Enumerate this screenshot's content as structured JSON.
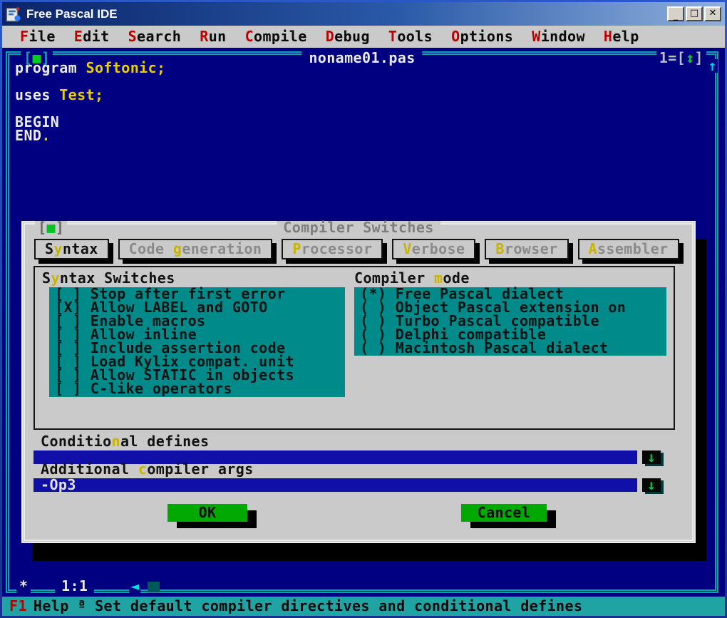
{
  "titlebar": {
    "title": "Free Pascal IDE",
    "minimize_glyph": "_",
    "maximize_glyph": "□",
    "close_glyph": "✕"
  },
  "menu": {
    "items": [
      {
        "hot": "F",
        "rest": "ile"
      },
      {
        "hot": "E",
        "rest": "dit"
      },
      {
        "hot": "S",
        "rest": "earch"
      },
      {
        "hot": "R",
        "rest": "un"
      },
      {
        "hot": "C",
        "rest": "ompile"
      },
      {
        "hot": "D",
        "rest": "ebug"
      },
      {
        "hot": "T",
        "rest": "ools"
      },
      {
        "hot": "O",
        "rest": "ptions"
      },
      {
        "hot": "W",
        "rest": "indow"
      },
      {
        "hot": "H",
        "rest": "elp"
      }
    ]
  },
  "editor": {
    "close_bracket_l": "[",
    "close_icon": "■",
    "close_bracket_r": "]",
    "title": "noname01.pas",
    "badge_pre": "1=[",
    "badge_icon": "↕",
    "badge_post": "]",
    "scroll_up_icon": "↑",
    "modified_star": "*",
    "cursor_pos": "1:1",
    "scroll_left_icon": "◄",
    "code": [
      {
        "kw": "program ",
        "id": "Softonic;"
      },
      {
        "kw": "",
        "id": ""
      },
      {
        "kw": "uses ",
        "id": "Test;"
      },
      {
        "kw": "",
        "id": ""
      },
      {
        "kw": "BEGIN",
        "id": ""
      },
      {
        "kw": "END",
        "id": "."
      }
    ]
  },
  "dialog": {
    "title": "Compiler Switches",
    "close_bracket_l": "[",
    "close_icon": "■",
    "close_bracket_r": "]",
    "tabs": [
      {
        "pre": "S",
        "hot": "y",
        "rest": "ntax"
      },
      {
        "pre": "Code ",
        "hot": "g",
        "rest": "eneration"
      },
      {
        "pre": "",
        "hot": "P",
        "rest": "rocessor"
      },
      {
        "pre": "",
        "hot": "V",
        "rest": "erbose"
      },
      {
        "pre": "",
        "hot": "B",
        "rest": "rowser"
      },
      {
        "pre": "",
        "hot": "A",
        "rest": "ssembler"
      }
    ],
    "syntax_switches": {
      "label": {
        "pre": "S",
        "hot": "y",
        "rest": "ntax Switches"
      },
      "items": [
        "[ ] Stop after first error",
        "[X] Allow LABEL and GOTO",
        "[ ] Enable macros",
        "[ ] Allow inline",
        "[ ] Include assertion code",
        "[ ] Load Kylix compat. unit",
        "[ ] Allow STATIC in objects",
        "[ ] C-like operators"
      ]
    },
    "compiler_mode": {
      "label": {
        "pre": "Compiler ",
        "hot": "m",
        "rest": "ode"
      },
      "items": [
        "(*) Free Pascal dialect",
        "( ) Object Pascal extension on",
        "( ) Turbo Pascal compatible",
        "( ) Delphi compatible",
        "( ) Macintosh Pascal dialect"
      ]
    },
    "conditional_defines": {
      "label": {
        "pre": "Conditio",
        "hot": "n",
        "rest": "al defines"
      },
      "value": "",
      "history_icon": "↓"
    },
    "additional_args": {
      "label": {
        "pre": "Additional ",
        "hot": "c",
        "rest": "ompiler args"
      },
      "value": "-Op3",
      "history_icon": "↓"
    },
    "buttons": {
      "ok": "OK",
      "cancel": "Cancel"
    }
  },
  "status": {
    "key": "F1",
    "label": "Help",
    "sep": "ª",
    "hint": "Set default compiler directives and conditional defines"
  },
  "colors": {
    "desktop_blue": "#000080",
    "frame_cyan": "#00a8a8",
    "panel_teal": "#008a8a",
    "dialog_gray": "#cacaca",
    "button_green": "#00a800",
    "menu_hot_red": "#bc0000",
    "dialog_hot_yellow": "#c8b400",
    "identifier_yellow": "#e8d000",
    "input_blue": "#1010a8"
  }
}
